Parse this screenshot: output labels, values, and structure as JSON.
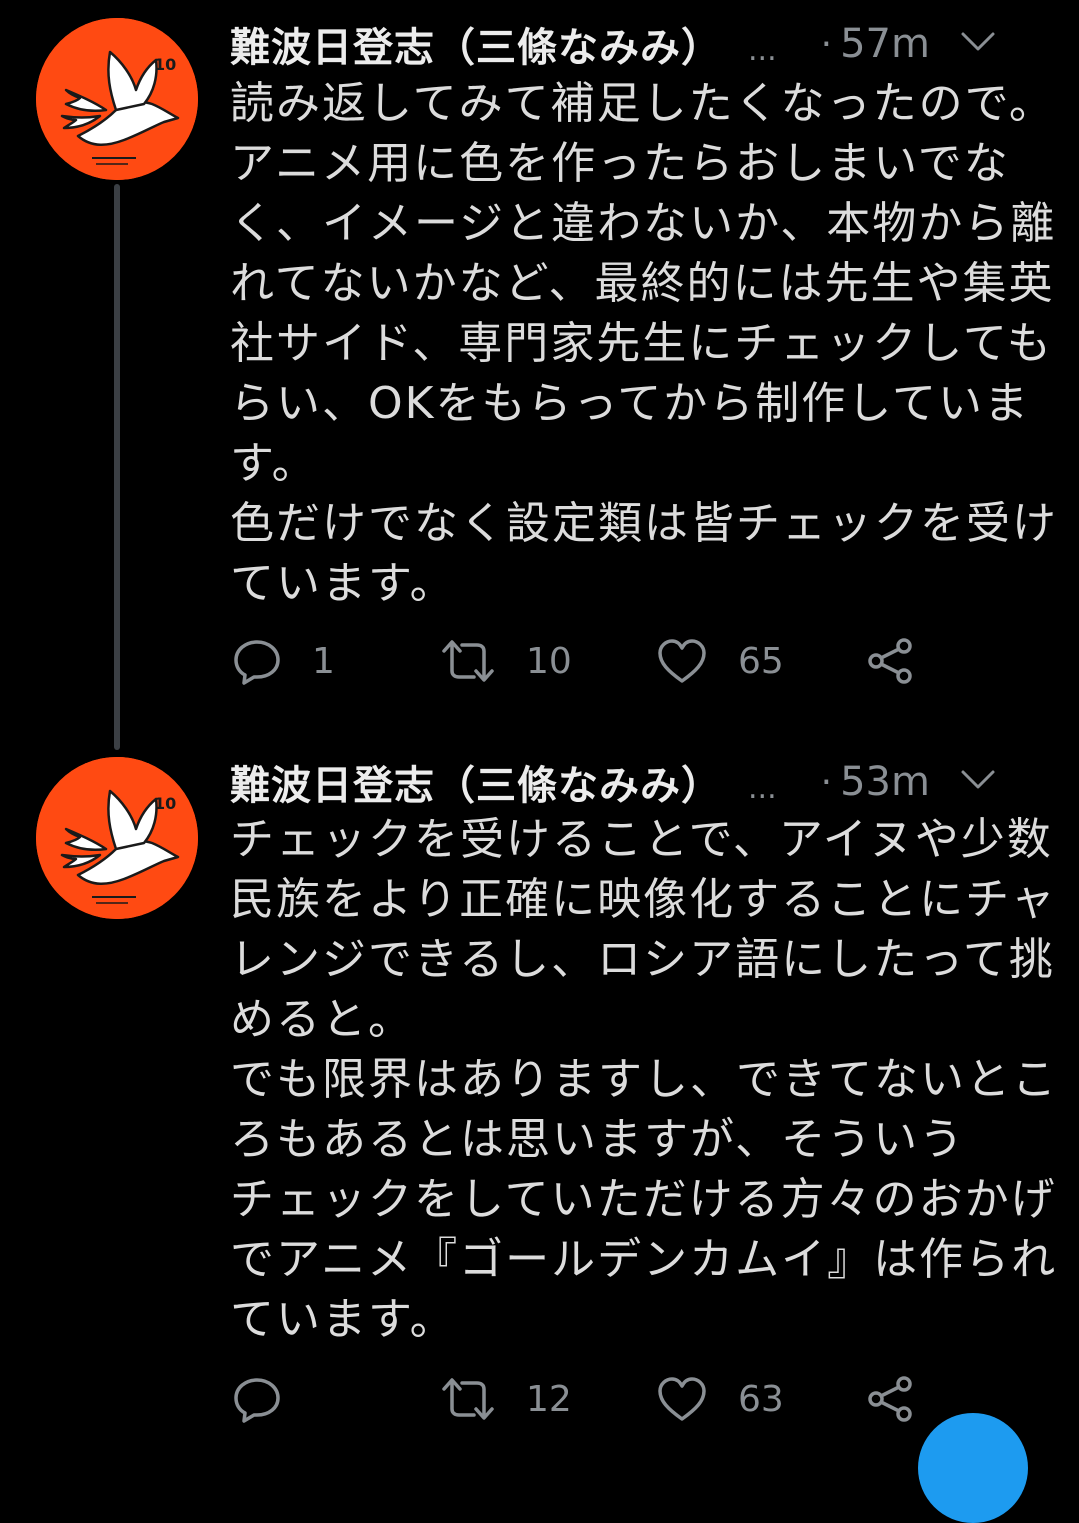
{
  "tweets": [
    {
      "author_name": "難波日登志（三條なみみ）",
      "more": "...",
      "time_sep": "·",
      "time": "57m",
      "avatar_text": "10",
      "body_lines": [
        "読み返してみて補足したくなったので。",
        "アニメ用に色を作ったらおしまいでな",
        "く、イメージと違わないか、本物から離",
        "れてないかなど、最終的には先生や集英",
        "社サイド、専門家先生にチェックしても",
        "らい、OKをもらってから制作していま",
        "す。",
        "色だけでなく設定類は皆チェックを受け",
        "ています。"
      ],
      "reply_count": "1",
      "retweet_count": "10",
      "like_count": "65"
    },
    {
      "author_name": "難波日登志（三條なみみ）",
      "more": "...",
      "time_sep": "·",
      "time": "53m",
      "avatar_text": "10",
      "body_lines": [
        "チェックを受けることで、アイヌや少数",
        "民族をより正確に映像化することにチャ",
        "レンジできるし、ロシア語にしたって挑",
        "めると。",
        "でも限界はありますし、できてないとこ",
        "ろもあるとは思いますが、そういう",
        "チェックをしていただける方々のおかげ",
        "でアニメ『ゴールデンカムイ』は作られ",
        "ています。"
      ],
      "reply_count": "",
      "retweet_count": "12",
      "like_count": "63"
    }
  ],
  "icons": {
    "reply": "reply-icon",
    "retweet": "retweet-icon",
    "like": "heart-icon",
    "share": "share-icon",
    "menu": "chevron-down-icon"
  },
  "colors": {
    "background": "#000000",
    "avatar_bg": "#ff4a12",
    "text": "#dcdcdc",
    "muted": "#8a8f94",
    "thread_line": "#3b3f44",
    "accent": "#1d9bf0"
  }
}
